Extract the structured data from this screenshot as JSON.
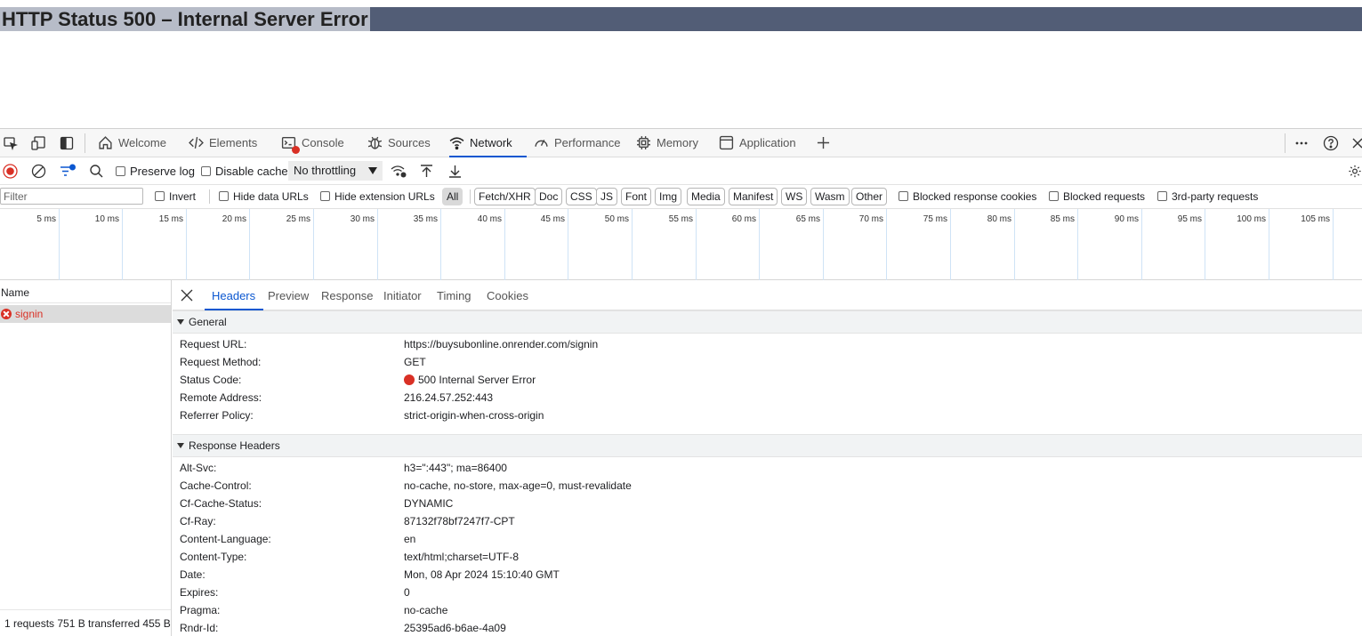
{
  "page": {
    "error_title": "HTTP Status 500 – Internal Server Error"
  },
  "devtools": {
    "tabs": [
      {
        "label": "Welcome",
        "icon": "home-icon"
      },
      {
        "label": "Elements",
        "icon": "code-icon"
      },
      {
        "label": "Console",
        "icon": "console-icon"
      },
      {
        "label": "Sources",
        "icon": "bug-icon"
      },
      {
        "label": "Network",
        "icon": "wifi-icon"
      },
      {
        "label": "Performance",
        "icon": "gauge-icon"
      },
      {
        "label": "Memory",
        "icon": "chip-icon"
      },
      {
        "label": "Application",
        "icon": "window-icon"
      }
    ],
    "active_tab": "Network",
    "accent_color": "#0b57d0",
    "error_color": "#d93025"
  },
  "toolbar": {
    "preserve_log": "Preserve log",
    "disable_cache": "Disable cache",
    "throttling": "No throttling"
  },
  "filter": {
    "placeholder": "Filter",
    "invert": "Invert",
    "hide_data_urls": "Hide data URLs",
    "hide_extension_urls": "Hide extension URLs",
    "types": [
      "All",
      "Fetch/XHR",
      "Doc",
      "CSS",
      "JS",
      "Font",
      "Img",
      "Media",
      "Manifest",
      "WS",
      "Wasm",
      "Other"
    ],
    "active_type": "All",
    "blocked_response_cookies": "Blocked response cookies",
    "blocked_requests": "Blocked requests",
    "third_party": "3rd-party requests"
  },
  "timeline": {
    "ticks": [
      "5 ms",
      "10 ms",
      "15 ms",
      "20 ms",
      "25 ms",
      "30 ms",
      "35 ms",
      "40 ms",
      "45 ms",
      "50 ms",
      "55 ms",
      "60 ms",
      "65 ms",
      "70 ms",
      "75 ms",
      "80 ms",
      "85 ms",
      "90 ms",
      "95 ms",
      "100 ms",
      "105 ms"
    ]
  },
  "requests": {
    "column": "Name",
    "items": [
      {
        "name": "signin",
        "status": "error"
      }
    ],
    "summary": "1 requests   751 B transferred   455 B"
  },
  "details": {
    "tabs": [
      "Headers",
      "Preview",
      "Response",
      "Initiator",
      "Timing",
      "Cookies"
    ],
    "active_tab": "Headers",
    "general_title": "General",
    "general": [
      {
        "key": "Request URL:",
        "value": "https://buysubonline.onrender.com/signin"
      },
      {
        "key": "Request Method:",
        "value": "GET"
      },
      {
        "key": "Status Code:",
        "value": "500 Internal Server Error"
      },
      {
        "key": "Remote Address:",
        "value": "216.24.57.252:443"
      },
      {
        "key": "Referrer Policy:",
        "value": "strict-origin-when-cross-origin"
      }
    ],
    "response_title": "Response Headers",
    "response_headers": [
      {
        "key": "Alt-Svc:",
        "value": "h3=\":443\"; ma=86400"
      },
      {
        "key": "Cache-Control:",
        "value": "no-cache, no-store, max-age=0, must-revalidate"
      },
      {
        "key": "Cf-Cache-Status:",
        "value": "DYNAMIC"
      },
      {
        "key": "Cf-Ray:",
        "value": "87132f78bf7247f7-CPT"
      },
      {
        "key": "Content-Language:",
        "value": "en"
      },
      {
        "key": "Content-Type:",
        "value": "text/html;charset=UTF-8"
      },
      {
        "key": "Date:",
        "value": "Mon, 08 Apr 2024 15:10:40 GMT"
      },
      {
        "key": "Expires:",
        "value": "0"
      },
      {
        "key": "Pragma:",
        "value": "no-cache"
      },
      {
        "key": "Rndr-Id:",
        "value": "25395ad6-b6ae-4a09"
      }
    ]
  }
}
